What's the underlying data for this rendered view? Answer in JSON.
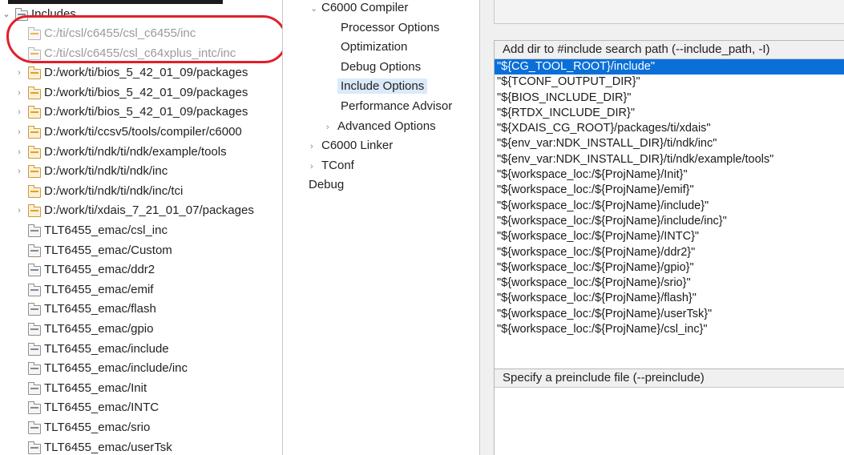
{
  "tree": {
    "root_label": "Includes",
    "items": [
      {
        "label": "C:/ti/csl/c6455/csl_c6455/inc",
        "arrow": "",
        "style": "grey"
      },
      {
        "label": "C:/ti/csl/c6455/csl_c64xplus_intc/inc",
        "arrow": "",
        "style": "grey"
      },
      {
        "label": "D:/work/ti/bios_5_42_01_09/packages",
        "arrow": "›",
        "style": "yellow"
      },
      {
        "label": "D:/work/ti/bios_5_42_01_09/packages",
        "arrow": "›",
        "style": "yellow"
      },
      {
        "label": "D:/work/ti/bios_5_42_01_09/packages",
        "arrow": "›",
        "style": "yellow"
      },
      {
        "label": "D:/work/ti/ccsv5/tools/compiler/c6000",
        "arrow": "›",
        "style": "yellow"
      },
      {
        "label": "D:/work/ti/ndk/ti/ndk/example/tools",
        "arrow": "›",
        "style": "yellow"
      },
      {
        "label": "D:/work/ti/ndk/ti/ndk/inc",
        "arrow": "›",
        "style": "yellow"
      },
      {
        "label": "D:/work/ti/ndk/ti/ndk/inc/tci",
        "arrow": "",
        "style": "yellow"
      },
      {
        "label": "D:/work/ti/xdais_7_21_01_07/packages",
        "arrow": "›",
        "style": "yellow"
      },
      {
        "label": "TLT6455_emac/csl_inc",
        "arrow": "",
        "style": "plain"
      },
      {
        "label": "TLT6455_emac/Custom",
        "arrow": "",
        "style": "plain"
      },
      {
        "label": "TLT6455_emac/ddr2",
        "arrow": "",
        "style": "plain"
      },
      {
        "label": "TLT6455_emac/emif",
        "arrow": "",
        "style": "plain"
      },
      {
        "label": "TLT6455_emac/flash",
        "arrow": "",
        "style": "plain"
      },
      {
        "label": "TLT6455_emac/gpio",
        "arrow": "",
        "style": "plain"
      },
      {
        "label": "TLT6455_emac/include",
        "arrow": "",
        "style": "plain"
      },
      {
        "label": "TLT6455_emac/include/inc",
        "arrow": "",
        "style": "plain"
      },
      {
        "label": "TLT6455_emac/Init",
        "arrow": "",
        "style": "plain"
      },
      {
        "label": "TLT6455_emac/INTC",
        "arrow": "",
        "style": "plain"
      },
      {
        "label": "TLT6455_emac/srio",
        "arrow": "",
        "style": "plain"
      },
      {
        "label": "TLT6455_emac/userTsk",
        "arrow": "",
        "style": "plain"
      }
    ]
  },
  "nav": {
    "items": [
      {
        "label": "C6000 Compiler",
        "arrow": "⌄",
        "level": 0,
        "selected": false
      },
      {
        "label": "Processor Options",
        "arrow": "",
        "level": 1,
        "selected": false
      },
      {
        "label": "Optimization",
        "arrow": "",
        "level": 1,
        "selected": false
      },
      {
        "label": "Debug Options",
        "arrow": "",
        "level": 1,
        "selected": false
      },
      {
        "label": "Include Options",
        "arrow": "",
        "level": 1,
        "selected": true
      },
      {
        "label": "Performance Advisor",
        "arrow": "",
        "level": 1,
        "selected": false
      },
      {
        "label": "Advanced Options",
        "arrow": "›",
        "level": 1,
        "selected": false
      },
      {
        "label": "C6000 Linker",
        "arrow": "›",
        "level": 0,
        "selected": false
      },
      {
        "label": "TConf",
        "arrow": "›",
        "level": 0,
        "selected": false
      },
      {
        "label": "Debug",
        "arrow": "",
        "level": -1,
        "selected": false
      }
    ]
  },
  "include_panel": {
    "heading": "Add dir to #include search path (--include_path, -I)",
    "paths": [
      "\"${CG_TOOL_ROOT}/include\"",
      "\"${TCONF_OUTPUT_DIR}\"",
      "\"${BIOS_INCLUDE_DIR}\"",
      "\"${RTDX_INCLUDE_DIR}\"",
      "\"${XDAIS_CG_ROOT}/packages/ti/xdais\"",
      "\"${env_var:NDK_INSTALL_DIR}/ti/ndk/inc\"",
      "\"${env_var:NDK_INSTALL_DIR}/ti/ndk/example/tools\"",
      "\"${workspace_loc:/${ProjName}/Init}\"",
      "\"${workspace_loc:/${ProjName}/emif}\"",
      "\"${workspace_loc:/${ProjName}/include}\"",
      "\"${workspace_loc:/${ProjName}/include/inc}\"",
      "\"${workspace_loc:/${ProjName}/INTC}\"",
      "\"${workspace_loc:/${ProjName}/ddr2}\"",
      "\"${workspace_loc:/${ProjName}/gpio}\"",
      "\"${workspace_loc:/${ProjName}/srio}\"",
      "\"${workspace_loc:/${ProjName}/flash}\"",
      "\"${workspace_loc:/${ProjName}/userTsk}\"",
      "\"${workspace_loc:/${ProjName}/csl_inc}\""
    ],
    "selected_index": 0
  },
  "preinclude_panel": {
    "heading": "Specify a preinclude file (--preinclude)"
  },
  "colors": {
    "selection": "#0a6fd8",
    "annotation": "#e0202a",
    "nav_selected": "#dbe9fa"
  }
}
